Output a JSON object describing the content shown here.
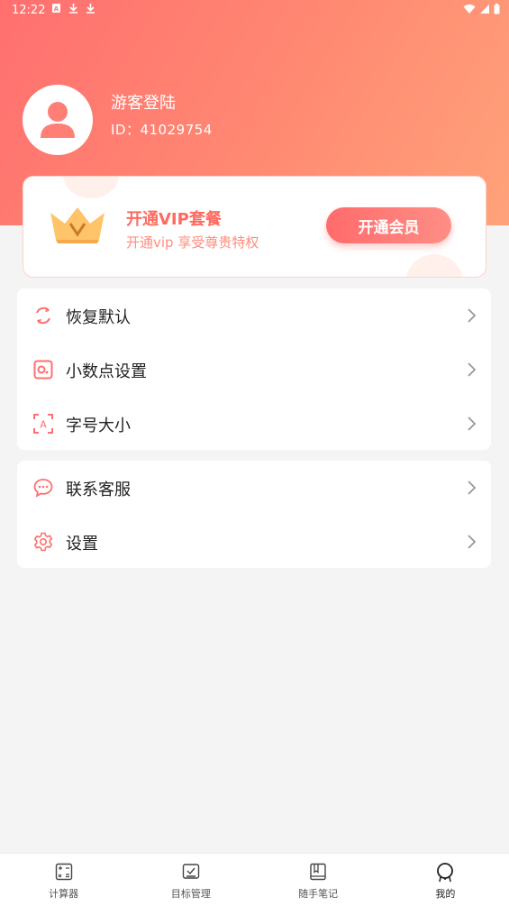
{
  "status_bar": {
    "time": "12:22",
    "left_icons": [
      "sim-card-icon",
      "download-icon",
      "download-icon"
    ],
    "right_icons": [
      "wifi-icon",
      "signal-icon",
      "battery-icon"
    ]
  },
  "profile": {
    "name": "游客登陆",
    "id_text": "ID：41029754"
  },
  "vip": {
    "title": "开通VIP套餐",
    "subtitle": "开通vip 享受尊贵特权",
    "button": "开通会员",
    "accent": "#ff6a5e"
  },
  "menu_group1": [
    {
      "label": "恢复默认",
      "icon": "refresh-icon"
    },
    {
      "label": "小数点设置",
      "icon": "decimal-icon"
    },
    {
      "label": "字号大小",
      "icon": "font-size-icon"
    }
  ],
  "menu_group2": [
    {
      "label": "联系客服",
      "icon": "chat-icon"
    },
    {
      "label": "设置",
      "icon": "gear-icon"
    }
  ],
  "tabs": [
    {
      "label": "计算器",
      "icon": "calculator-icon"
    },
    {
      "label": "目标管理",
      "icon": "checklist-icon"
    },
    {
      "label": "随手笔记",
      "icon": "notebook-icon"
    },
    {
      "label": "我的",
      "icon": "profile-icon"
    }
  ]
}
